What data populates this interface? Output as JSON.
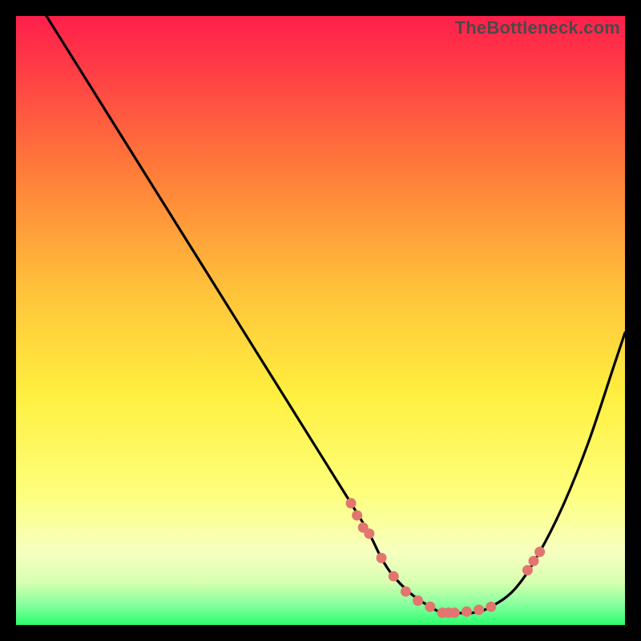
{
  "watermark": "TheBottleneck.com",
  "colors": {
    "gradient_top": "#ff1f4b",
    "gradient_mid1": "#ff7a3a",
    "gradient_mid2": "#ffef3f",
    "gradient_mid3": "#f7ffa8",
    "gradient_bottom": "#2cff6e",
    "curve": "#000000",
    "marker": "#e2766e",
    "frame_bg": "#000000"
  },
  "chart_data": {
    "type": "line",
    "title": "",
    "xlabel": "",
    "ylabel": "",
    "xlim": [
      0,
      100
    ],
    "ylim": [
      0,
      100
    ],
    "grid": false,
    "legend": false,
    "series": [
      {
        "name": "bottleneck-curve",
        "x": [
          5,
          10,
          15,
          20,
          25,
          30,
          35,
          40,
          45,
          50,
          55,
          58,
          60,
          62,
          65,
          68,
          70,
          72,
          75,
          78,
          82,
          86,
          90,
          94,
          98,
          100
        ],
        "y": [
          100,
          92,
          84,
          76,
          68,
          60,
          52,
          44,
          36,
          28,
          20,
          15,
          11,
          8,
          5,
          3,
          2,
          2,
          2,
          3,
          6,
          12,
          20,
          30,
          42,
          48
        ]
      }
    ],
    "markers": {
      "name": "highlight-points",
      "x": [
        55,
        56,
        57,
        58,
        60,
        62,
        64,
        66,
        68,
        70,
        71,
        72,
        74,
        76,
        78,
        84,
        85,
        86
      ],
      "y": [
        20,
        18,
        16,
        15,
        11,
        8,
        5.5,
        4,
        3,
        2,
        2,
        2,
        2.2,
        2.5,
        3,
        9,
        10.5,
        12
      ]
    }
  }
}
